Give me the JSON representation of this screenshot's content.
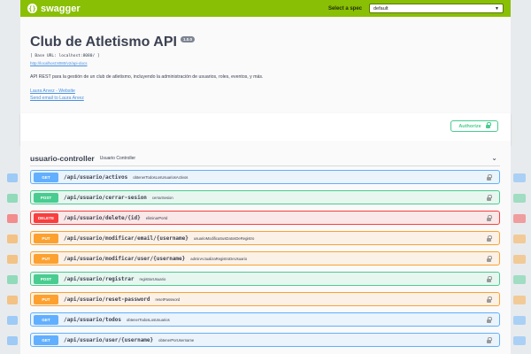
{
  "topbar": {
    "logo_text": "swagger",
    "logo_badge": "{}",
    "spec_label": "Select a spec",
    "spec_value": "default"
  },
  "info": {
    "title": "Club de Atletismo API",
    "version": "1.0.0",
    "base_url": "[ Base URL: localhost:8080/ ]",
    "docs_link": "http://localhost:8080/v2/api-docs",
    "description": "API REST para la gestión de un club de atletismo, incluyendo la administración de usuarios, roles, eventos, y más.",
    "contact_website": "Laura Arvez - Website",
    "contact_email": "Send email to Laura Arvez"
  },
  "auth": {
    "label": "Authorize"
  },
  "tag": {
    "name": "usuario-controller",
    "description": "Usuario Controller"
  },
  "operations": [
    {
      "method": "GET",
      "path": "/api/usuario/activos",
      "summary": "obtenerTodosLosUsuariosActivos"
    },
    {
      "method": "POST",
      "path": "/api/usuario/cerrar-sesion",
      "summary": "cerrarSesion"
    },
    {
      "method": "DELETE",
      "path": "/api/usuario/delete/{id}",
      "summary": "eliminarPorId"
    },
    {
      "method": "PUT",
      "path": "/api/usuario/modificar/email/{username}",
      "summary": "usuarioModificaSusDatosDeRegistro"
    },
    {
      "method": "PUT",
      "path": "/api/usuario/modificar/user/{username}",
      "summary": "adminActualizaRegistroDeUsuario"
    },
    {
      "method": "POST",
      "path": "/api/usuario/registrar",
      "summary": "registrarUsuario"
    },
    {
      "method": "PUT",
      "path": "/api/usuario/reset-password",
      "summary": "resetPassword"
    },
    {
      "method": "GET",
      "path": "/api/usuario/todos",
      "summary": "obtenerTodosLosUsuarios"
    },
    {
      "method": "GET",
      "path": "/api/usuario/user/{username}",
      "summary": "obtenerPorUsername"
    }
  ],
  "colors": {
    "topbar": "#89bf04",
    "get": "#61affe",
    "post": "#49cc90",
    "delete": "#f93e3e",
    "put": "#fca130"
  }
}
